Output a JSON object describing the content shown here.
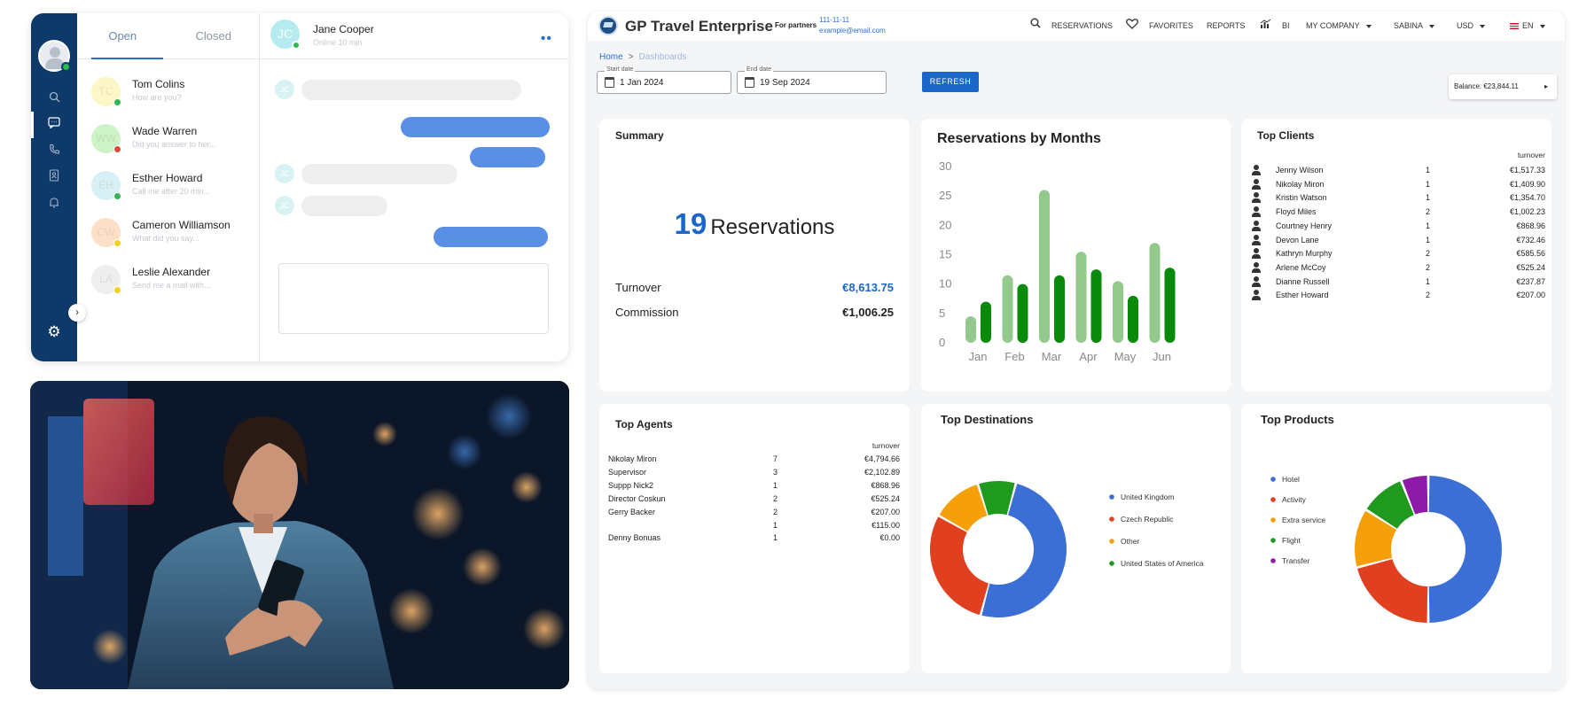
{
  "chat": {
    "tabs": [
      {
        "label": "Open"
      },
      {
        "label": "Closed"
      }
    ],
    "contacts": [
      {
        "name": "Tom Colins",
        "preview": "How are you?",
        "initials": "TC",
        "avatar_color": "#fdf6c7",
        "status_color": "#2fb84f"
      },
      {
        "name": "Wade Warren",
        "preview": "Did you answer to her...",
        "initials": "WW",
        "avatar_color": "#cdf3c6",
        "status_color": "#e0493a"
      },
      {
        "name": "Esther Howard",
        "preview": "Call me after 20 min...",
        "initials": "EH",
        "avatar_color": "#d7f0f6",
        "status_color": "#2fb84f"
      },
      {
        "name": "Cameron Williamson",
        "preview": "What did you say...",
        "initials": "CW",
        "avatar_color": "#fde0c8",
        "status_color": "#f4d21c"
      },
      {
        "name": "Leslie Alexander",
        "preview": "Send me a mail with...",
        "initials": "LA",
        "avatar_color": "#eeeeee",
        "status_color": "#f4d21c"
      }
    ],
    "conversation": {
      "name": "Jane Cooper",
      "status": "Online 10 min",
      "initials": "JC"
    }
  },
  "dashboard": {
    "brand": "GP Travel Enterprise",
    "partners": {
      "label": "For partners",
      "phone": "111-11-11",
      "email": "example@email.com"
    },
    "nav": {
      "reservations": "RESERVATIONS",
      "favorites": "FAVORITES",
      "reports": "REPORTS",
      "bi": "BI",
      "company": "MY COMPANY",
      "user": "SABINA",
      "currency": "USD",
      "language": "EN"
    },
    "breadcrumb": {
      "home": "Home",
      "separator": ">",
      "current": "Dashboards"
    },
    "filters": {
      "start_label": "Start date",
      "start_value": "1 Jan 2024",
      "end_label": "End date",
      "end_value": "19 Sep 2024",
      "refresh": "REFRESH"
    },
    "balance": "Balance: €23,844.11",
    "summary": {
      "title": "Summary",
      "count": "19",
      "count_label": "Reservations",
      "turnover_label": "Turnover",
      "turnover_value": "€8,613.75",
      "commission_label": "Commission",
      "commission_value": "€1,006.25"
    },
    "top_clients": {
      "title": "Top Clients",
      "column": "turnover",
      "rows": [
        {
          "name": "Jenny Wilson",
          "count": "1",
          "value": "€1,517.33"
        },
        {
          "name": "Nikolay Miron",
          "count": "1",
          "value": "€1,409.90"
        },
        {
          "name": "Kristin Watson",
          "count": "1",
          "value": "€1,354.70"
        },
        {
          "name": "Floyd Miles",
          "count": "2",
          "value": "€1,002.23"
        },
        {
          "name": "Courtney Henry",
          "count": "1",
          "value": "€868.96"
        },
        {
          "name": "Devon Lane",
          "count": "1",
          "value": "€732.46"
        },
        {
          "name": "Kathryn Murphy",
          "count": "2",
          "value": "€585.56"
        },
        {
          "name": "Arlene McCoy",
          "count": "2",
          "value": "€525.24"
        },
        {
          "name": "Dianne Russell",
          "count": "1",
          "value": "€237.87"
        },
        {
          "name": "Esther Howard",
          "count": "2",
          "value": "€207.00"
        }
      ]
    },
    "top_agents": {
      "title": "Top Agents",
      "column": "turnover",
      "rows": [
        {
          "name": "Nikolay Miron",
          "count": "7",
          "value": "€4,794.66"
        },
        {
          "name": "Supervisor",
          "count": "3",
          "value": "€2,102.89"
        },
        {
          "name": "Suppp Nick2",
          "count": "1",
          "value": "€868.96"
        },
        {
          "name": "Director Coskun",
          "count": "2",
          "value": "€525.24"
        },
        {
          "name": "Gerry Backer",
          "count": "2",
          "value": "€207.00"
        },
        {
          "name": "",
          "count": "1",
          "value": "€115.00"
        },
        {
          "name": "Denny Bonuas",
          "count": "1",
          "value": "€0.00"
        }
      ]
    }
  },
  "chart_data": [
    {
      "type": "bar",
      "title": "Reservations by Months",
      "categories": [
        "Jan",
        "Feb",
        "Mar",
        "Apr",
        "May",
        "Jun"
      ],
      "series": [
        {
          "values": [
            4.5,
            11.5,
            26,
            15.5,
            10.5,
            17
          ],
          "color": "#94c98d"
        },
        {
          "values": [
            7,
            10,
            11.5,
            12.5,
            8,
            12.8
          ],
          "color": "#0a8a0a"
        }
      ],
      "ylim": [
        0,
        30
      ],
      "yticks": [
        0,
        5,
        10,
        15,
        20,
        25,
        30
      ],
      "grid": false
    },
    {
      "type": "pie",
      "title": "Top Destinations",
      "labels": [
        "United Kingdom",
        "Czech Republic",
        "Other",
        "United States of America"
      ],
      "values": [
        50,
        29,
        12,
        9
      ],
      "colors": [
        "#3b6fd6",
        "#e0401f",
        "#f59f0b",
        "#1f9a1f"
      ],
      "legend": "right"
    },
    {
      "type": "pie",
      "title": "Top Products",
      "labels": [
        "Hotel",
        "Activity",
        "Extra service",
        "Flight",
        "Transfer"
      ],
      "values": [
        50,
        21,
        13,
        10,
        6
      ],
      "colors": [
        "#3b6fd6",
        "#e0401f",
        "#f59f0b",
        "#1f9a1f",
        "#8e1aa8"
      ],
      "legend": "left"
    }
  ]
}
